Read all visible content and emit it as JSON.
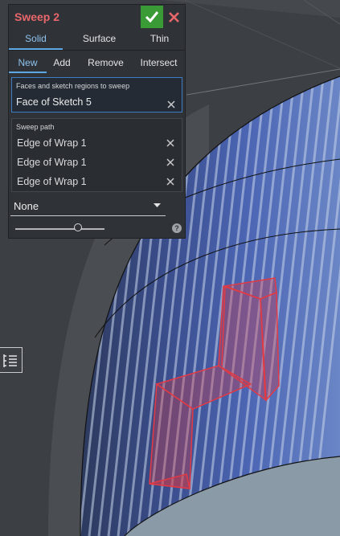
{
  "feature": {
    "title": "Sweep 2"
  },
  "tabs": [
    "Solid",
    "Surface",
    "Thin"
  ],
  "operations": [
    "New",
    "Add",
    "Remove",
    "Intersect"
  ],
  "faces": {
    "label": "Faces and sketch regions to sweep",
    "value": "Face of Sketch 5"
  },
  "sweep_path": {
    "label": "Sweep path",
    "items": [
      "Edge of Wrap 1",
      "Edge of Wrap 1",
      "Edge of Wrap 1"
    ]
  },
  "profile_control": {
    "value": "None"
  },
  "slider": {
    "position": 0.7
  },
  "help": {
    "glyph": "?"
  },
  "colors": {
    "accent": "#5ea7e3",
    "title": "#e8676b",
    "confirm": "#3a9a36",
    "cancel": "#e8676b",
    "preview": "#e23a45"
  },
  "icons": [
    "checkmark-icon",
    "close-icon",
    "chevron-down-icon",
    "help-icon",
    "feature-list-icon"
  ]
}
